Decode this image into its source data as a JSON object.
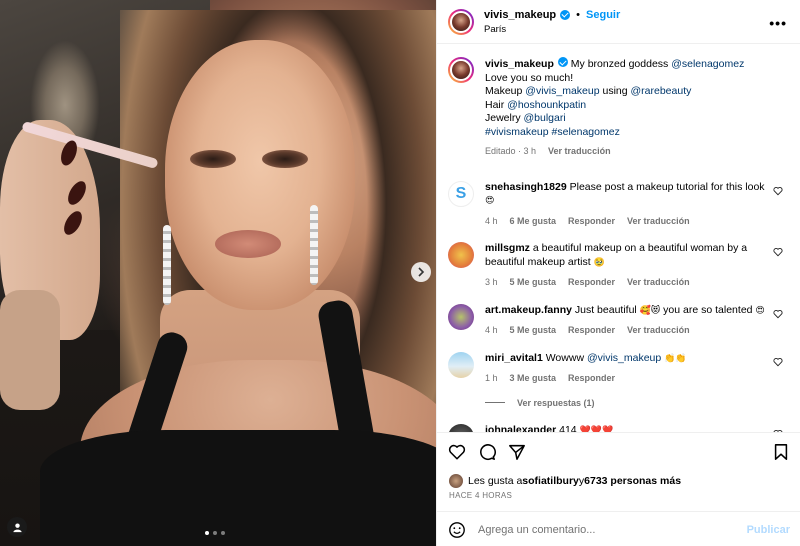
{
  "header": {
    "username": "vivis_makeup",
    "follow_label": "Seguir",
    "location": "París",
    "more_label": "•••"
  },
  "caption": {
    "username": "vivis_makeup",
    "text1": " My bronzed goddess ",
    "mention1": "@selenagomez",
    "text2": " Love you so much!",
    "line2_label": "Makeup ",
    "line2_mention1": "@vivis_makeup",
    "line2_mid": " using ",
    "line2_mention2": "@rarebeauty",
    "line3_label": "Hair ",
    "line3_mention": "@hoshounkpatin",
    "line4_label": "Jewelry ",
    "line4_mention": "@bulgari",
    "hashtags": "#vivismakeup #selenagomez",
    "edited": "Editado",
    "time": "3 h",
    "translate": "Ver traducción"
  },
  "comments": [
    {
      "username": "snehasingh1829",
      "text": " Please post a makeup tutorial for this look ",
      "emoji": "😍",
      "time": "4 h",
      "likes": "6 Me gusta",
      "reply": "Responder",
      "translate": "Ver traducción"
    },
    {
      "username": "millsgmz",
      "text": " a beautiful makeup on a beautiful woman by a beautiful makeup artist ",
      "emoji": "🥹",
      "time": "3 h",
      "likes": "5 Me gusta",
      "reply": "Responder",
      "translate": "Ver traducción"
    },
    {
      "username": "art.makeup.fanny",
      "text": " Just beautiful ",
      "emoji": "🥰😻",
      "text2": " you are so talented ",
      "emoji2": "😍",
      "time": "4 h",
      "likes": "5 Me gusta",
      "reply": "Responder",
      "translate": "Ver traducción"
    },
    {
      "username": "miri_avital1",
      "text": " Wowww ",
      "mention": "@vivis_makeup",
      "emoji": " 👏👏",
      "time": "1 h",
      "likes": "3 Me gusta",
      "reply": "Responder"
    },
    {
      "username": "johnalexander",
      "text": " 414 ",
      "emoji": "❤️❤️❤️"
    }
  ],
  "view_replies": "Ver respuestas (1)",
  "likes": {
    "prefix": "Les gusta a ",
    "user": "sofiatilbury",
    "mid": " y ",
    "count": "6733 personas más"
  },
  "timestamp": "HACE 4 HORAS",
  "composer": {
    "placeholder": "Agrega un comentario...",
    "publish": "Publicar"
  },
  "colors": {
    "link": "#00376b",
    "accent": "#0095f6",
    "muted": "#737373"
  }
}
